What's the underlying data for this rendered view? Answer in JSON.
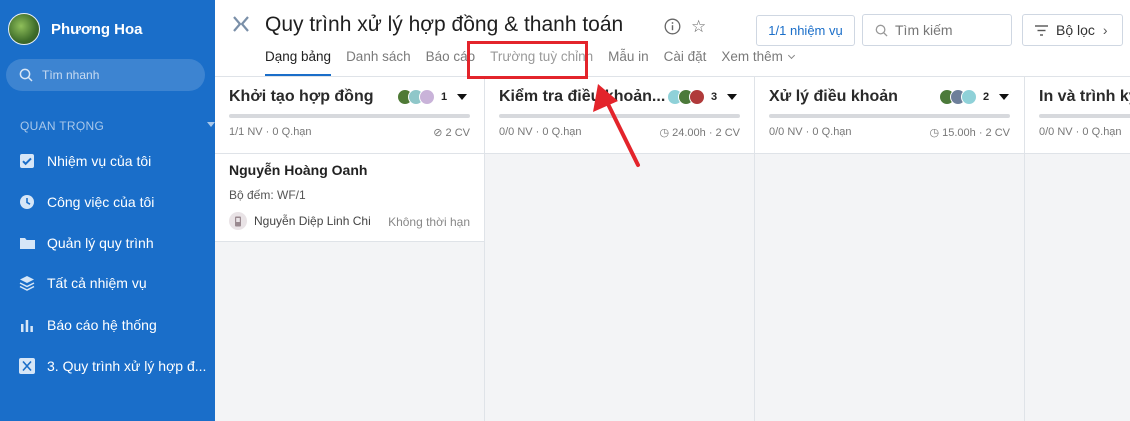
{
  "sidebar": {
    "user_name": "Phương Hoa",
    "search_placeholder": "Tìm nhanh",
    "section_label": "QUAN TRỌNG",
    "items": [
      {
        "label": "Nhiệm vụ của tôi",
        "icon": "checkbox-icon"
      },
      {
        "label": "Công việc của tôi",
        "icon": "clock-icon"
      },
      {
        "label": "Quản lý quy trình",
        "icon": "folder-icon"
      },
      {
        "label": "Tất cả nhiệm vụ",
        "icon": "layers-icon"
      },
      {
        "label": "Báo cáo hệ thống",
        "icon": "bar-chart-icon"
      },
      {
        "label": "3. Quy trình xử lý hợp đ...",
        "icon": "workflow-icon"
      }
    ]
  },
  "header": {
    "title": "Quy trình xử lý hợp đồng & thanh toán",
    "tasks_button": "1/1 nhiệm vụ",
    "search_placeholder": "Tìm kiếm",
    "filter_label": "Bộ lọc"
  },
  "tabs": [
    {
      "label": "Dạng bảng",
      "active": true
    },
    {
      "label": "Danh sách"
    },
    {
      "label": "Báo cáo"
    },
    {
      "label": "Trường tuỳ chỉnh",
      "highlighted": true
    },
    {
      "label": "Mẫu in"
    },
    {
      "label": "Cài đặt"
    },
    {
      "label": "Xem thêm"
    }
  ],
  "columns": [
    {
      "title": "Khởi tạo hợp đồng",
      "count": "1",
      "stat": "1/1 NV · 0 Q.hạn",
      "right": "2 CV"
    },
    {
      "title": "Kiểm tra điều khoản...",
      "count": "3",
      "stat": "0/0 NV · 0 Q.hạn",
      "right": "24.00h · 2 CV"
    },
    {
      "title": "Xử lý điều khoản",
      "count": "2",
      "stat": "0/0 NV · 0 Q.hạn",
      "right": "15.00h · 2 CV"
    },
    {
      "title": "In và trình ký",
      "stat": "0/0 NV · 0 Q.hạn"
    }
  ],
  "card": {
    "title": "Nguyễn Hoàng Oanh",
    "counter": "Bộ đếm: WF/1",
    "assignee": "Nguyễn Diệp Linh Chi",
    "due": "Không thời hạn"
  },
  "colors": {
    "sidebar": "#1a6ec9",
    "accent": "#1a6ec9",
    "highlight": "#e3242b"
  }
}
